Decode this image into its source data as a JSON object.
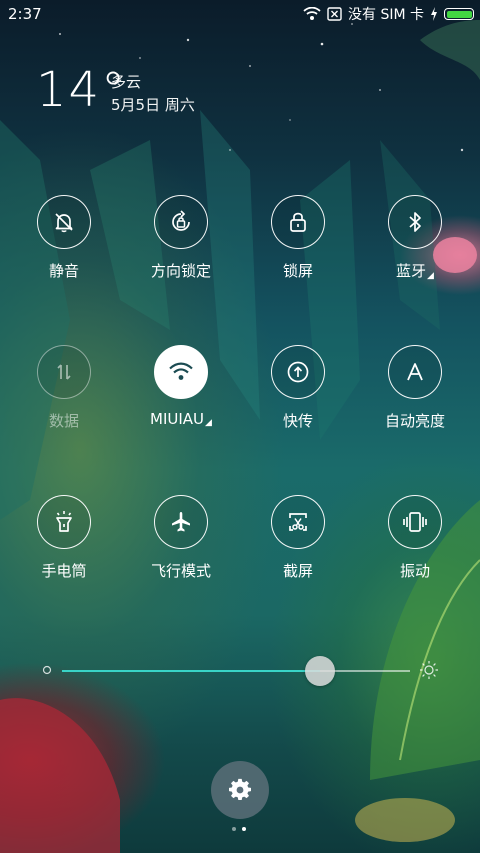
{
  "status_bar": {
    "time": "2:37",
    "no_sim_text": "没有 SIM 卡",
    "battery_level": 1.0,
    "battery_color": "#42d742",
    "icons": [
      "wifi-icon",
      "sim-card-x-icon",
      "charging-bolt-icon",
      "battery-icon"
    ]
  },
  "weather": {
    "temperature": "14°",
    "condition": "多云",
    "date": "5月5日 周六"
  },
  "toggles": [
    {
      "label": "静音",
      "icon": "bell-off-icon",
      "state": "off"
    },
    {
      "label": "方向锁定",
      "icon": "rotation-lock-icon",
      "state": "off"
    },
    {
      "label": "锁屏",
      "icon": "lock-icon",
      "state": "off"
    },
    {
      "label": "蓝牙",
      "icon": "bluetooth-icon",
      "state": "off",
      "has_more": true
    },
    {
      "label": "数据",
      "icon": "mobile-data-icon",
      "state": "disabled"
    },
    {
      "label": "MIUIAU",
      "icon": "wifi-icon",
      "state": "on",
      "has_more": true
    },
    {
      "label": "快传",
      "icon": "quick-transfer-icon",
      "state": "off"
    },
    {
      "label": "自动亮度",
      "icon": "auto-brightness-icon",
      "state": "off"
    },
    {
      "label": "手电筒",
      "icon": "flashlight-icon",
      "state": "off"
    },
    {
      "label": "飞行模式",
      "icon": "airplane-icon",
      "state": "off"
    },
    {
      "label": "截屏",
      "icon": "screenshot-icon",
      "state": "off"
    },
    {
      "label": "振动",
      "icon": "vibrate-icon",
      "state": "off"
    }
  ],
  "brightness": {
    "level": 0.74,
    "accent_color": "#39d4c7"
  },
  "settings": {
    "icon": "gear-icon"
  },
  "pager": {
    "pages": 2,
    "current": 2
  }
}
